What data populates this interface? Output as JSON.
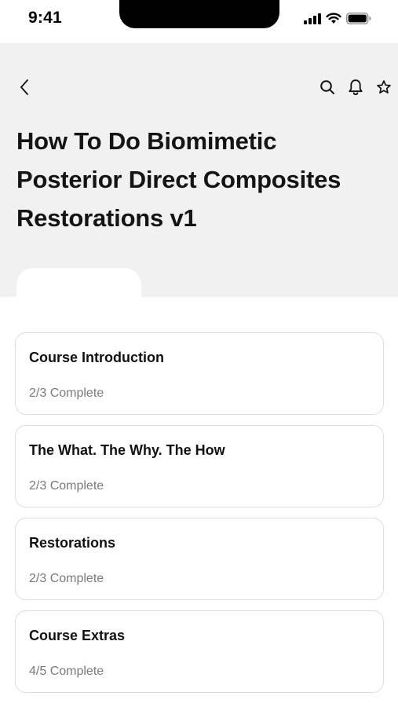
{
  "status_bar": {
    "time": "9:41",
    "icons": [
      "signal-icon",
      "wifi-icon",
      "battery-icon"
    ]
  },
  "header": {
    "back_icon": "chevron-left-icon",
    "actions": [
      "search-icon",
      "bell-icon",
      "star-icon"
    ],
    "title": "How To Do Biomimetic Posterior Direct Composites Restorations v1",
    "background_color": "#f1f1f1"
  },
  "modules": [
    {
      "title": "Course Introduction",
      "progress": "2/3 Complete"
    },
    {
      "title": "The What. The Why. The How",
      "progress": "2/3 Complete"
    },
    {
      "title": "Restorations",
      "progress": "2/3 Complete"
    },
    {
      "title": "Course Extras",
      "progress": "4/5 Complete"
    }
  ]
}
